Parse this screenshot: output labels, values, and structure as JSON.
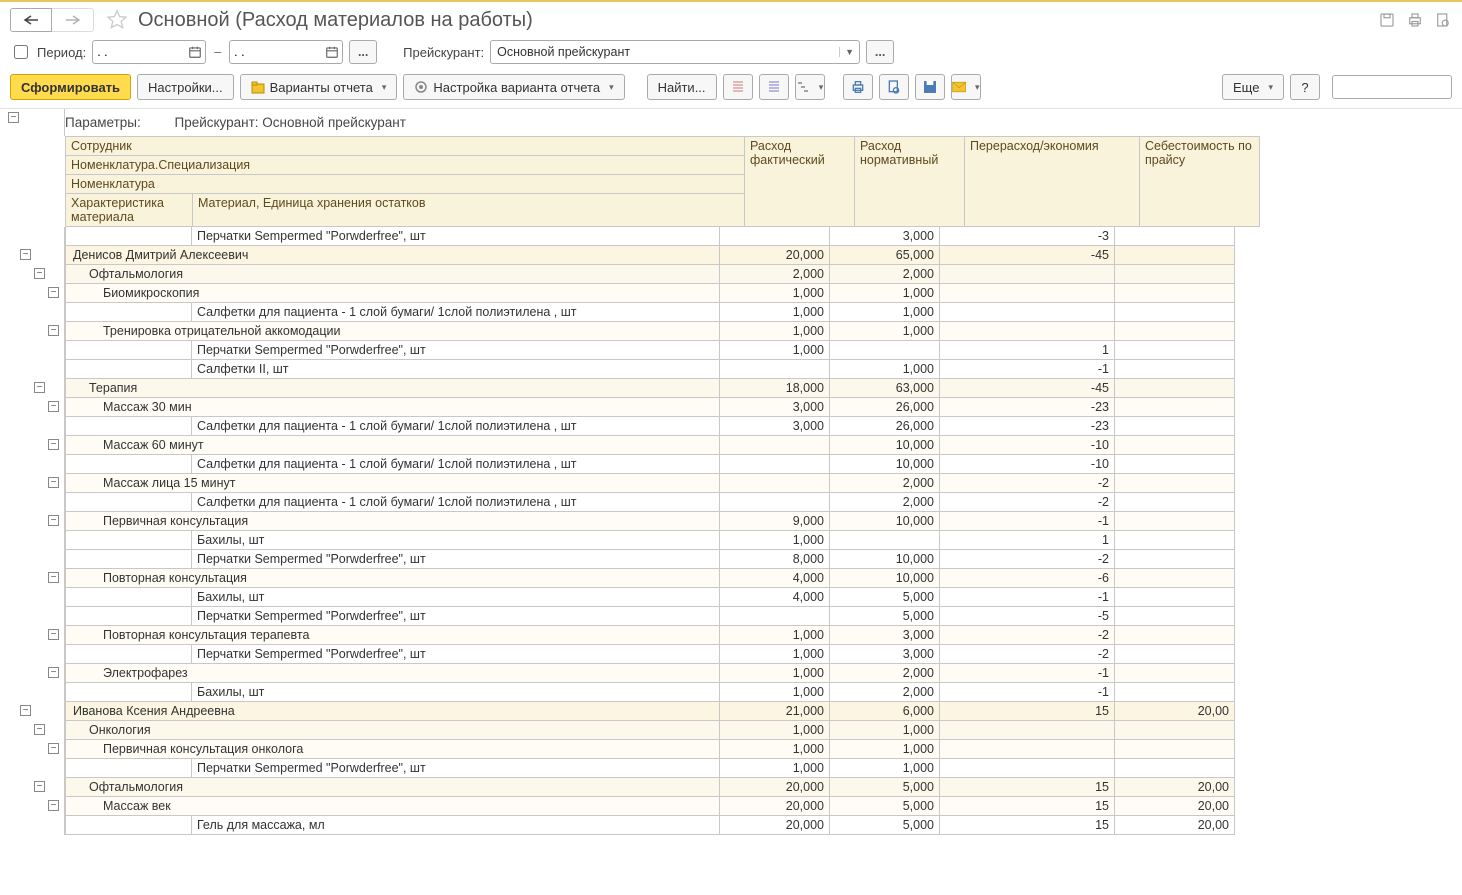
{
  "title": "Основной (Расход материалов на работы)",
  "period": {
    "label": "Период:",
    "from": ". .",
    "to": ". ."
  },
  "pricelist": {
    "label": "Прейскурант:",
    "value": "Основной прейскурант"
  },
  "toolbar": {
    "generate": "Сформировать",
    "settings": "Настройки...",
    "variants": "Варианты отчета",
    "variant_settings": "Настройка варианта отчета",
    "find": "Найти...",
    "more": "Еще",
    "help": "?"
  },
  "params_label": "Параметры:",
  "params_value": "Прейскурант: Основной прейскурант",
  "headers": {
    "employee": "Сотрудник",
    "spec": "Номенклатура.Специализация",
    "nom": "Номенклатура",
    "char": "Характеристика материала",
    "material": "Материал, Единица хранения остатков",
    "c1": "Расход фактический",
    "c2": "Расход нормативный",
    "c3": "Перерасход/экономия",
    "c4": "Себестоимость по прайсу"
  },
  "rows": [
    {
      "lvl": 4,
      "txt": "Перчатки Sempermed \"Porwderfree\", шт",
      "v": [
        "",
        "3,000",
        "-3",
        ""
      ]
    },
    {
      "lvl": 1,
      "txt": "Денисов Дмитрий Алексеевич",
      "v": [
        "20,000",
        "65,000",
        "-45",
        ""
      ],
      "exp": 1
    },
    {
      "lvl": 2,
      "txt": "Офтальмология",
      "v": [
        "2,000",
        "2,000",
        "",
        ""
      ],
      "exp": 1
    },
    {
      "lvl": 3,
      "txt": "Биомикроскопия",
      "v": [
        "1,000",
        "1,000",
        "",
        ""
      ],
      "exp": 1
    },
    {
      "lvl": 4,
      "txt": "Салфетки для пациента - 1 слой бумаги/ 1слой полиэтилена , шт",
      "v": [
        "1,000",
        "1,000",
        "",
        ""
      ]
    },
    {
      "lvl": 3,
      "txt": "Тренировка отрицательной аккомодации",
      "v": [
        "1,000",
        "1,000",
        "",
        ""
      ],
      "exp": 1
    },
    {
      "lvl": 4,
      "txt": "Перчатки Sempermed \"Porwderfree\", шт",
      "v": [
        "1,000",
        "",
        "1",
        ""
      ]
    },
    {
      "lvl": 4,
      "txt": "Салфетки II, шт",
      "v": [
        "",
        "1,000",
        "-1",
        ""
      ]
    },
    {
      "lvl": 2,
      "txt": "Терапия",
      "v": [
        "18,000",
        "63,000",
        "-45",
        ""
      ],
      "exp": 1
    },
    {
      "lvl": 3,
      "txt": "Массаж 30 мин",
      "v": [
        "3,000",
        "26,000",
        "-23",
        ""
      ],
      "exp": 1
    },
    {
      "lvl": 4,
      "txt": "Салфетки для пациента - 1 слой бумаги/ 1слой полиэтилена , шт",
      "v": [
        "3,000",
        "26,000",
        "-23",
        ""
      ]
    },
    {
      "lvl": 3,
      "txt": "Массаж 60 минут",
      "v": [
        "",
        "10,000",
        "-10",
        ""
      ],
      "exp": 1
    },
    {
      "lvl": 4,
      "txt": "Салфетки для пациента - 1 слой бумаги/ 1слой полиэтилена , шт",
      "v": [
        "",
        "10,000",
        "-10",
        ""
      ]
    },
    {
      "lvl": 3,
      "txt": "Массаж лица 15 минут",
      "v": [
        "",
        "2,000",
        "-2",
        ""
      ],
      "exp": 1
    },
    {
      "lvl": 4,
      "txt": "Салфетки для пациента - 1 слой бумаги/ 1слой полиэтилена , шт",
      "v": [
        "",
        "2,000",
        "-2",
        ""
      ]
    },
    {
      "lvl": 3,
      "txt": "Первичная консультация",
      "v": [
        "9,000",
        "10,000",
        "-1",
        ""
      ],
      "exp": 1
    },
    {
      "lvl": 4,
      "txt": "Бахилы, шт",
      "v": [
        "1,000",
        "",
        "1",
        ""
      ]
    },
    {
      "lvl": 4,
      "txt": "Перчатки Sempermed \"Porwderfree\", шт",
      "v": [
        "8,000",
        "10,000",
        "-2",
        ""
      ]
    },
    {
      "lvl": 3,
      "txt": "Повторная консультация",
      "v": [
        "4,000",
        "10,000",
        "-6",
        ""
      ],
      "exp": 1
    },
    {
      "lvl": 4,
      "txt": "Бахилы, шт",
      "v": [
        "4,000",
        "5,000",
        "-1",
        ""
      ]
    },
    {
      "lvl": 4,
      "txt": "Перчатки Sempermed \"Porwderfree\", шт",
      "v": [
        "",
        "5,000",
        "-5",
        ""
      ]
    },
    {
      "lvl": 3,
      "txt": "Повторная консультация терапевта",
      "v": [
        "1,000",
        "3,000",
        "-2",
        ""
      ],
      "exp": 1
    },
    {
      "lvl": 4,
      "txt": "Перчатки Sempermed \"Porwderfree\", шт",
      "v": [
        "1,000",
        "3,000",
        "-2",
        ""
      ]
    },
    {
      "lvl": 3,
      "txt": "Электрофарез",
      "v": [
        "1,000",
        "2,000",
        "-1",
        ""
      ],
      "exp": 1
    },
    {
      "lvl": 4,
      "txt": "Бахилы, шт",
      "v": [
        "1,000",
        "2,000",
        "-1",
        ""
      ]
    },
    {
      "lvl": 1,
      "txt": "Иванова Ксения Андреевна",
      "v": [
        "21,000",
        "6,000",
        "15",
        "20,00"
      ],
      "exp": 1
    },
    {
      "lvl": 2,
      "txt": "Онкология",
      "v": [
        "1,000",
        "1,000",
        "",
        ""
      ],
      "exp": 1
    },
    {
      "lvl": 3,
      "txt": "Первичная консультация онколога",
      "v": [
        "1,000",
        "1,000",
        "",
        ""
      ],
      "exp": 1
    },
    {
      "lvl": 4,
      "txt": "Перчатки Sempermed \"Porwderfree\", шт",
      "v": [
        "1,000",
        "1,000",
        "",
        ""
      ]
    },
    {
      "lvl": 2,
      "txt": "Офтальмология",
      "v": [
        "20,000",
        "5,000",
        "15",
        "20,00"
      ],
      "exp": 1
    },
    {
      "lvl": 3,
      "txt": "Массаж век",
      "v": [
        "20,000",
        "5,000",
        "15",
        "20,00"
      ],
      "exp": 1
    },
    {
      "lvl": 4,
      "txt": "Гель для массажа, мл",
      "v": [
        "20,000",
        "5,000",
        "15",
        "20,00"
      ]
    }
  ]
}
